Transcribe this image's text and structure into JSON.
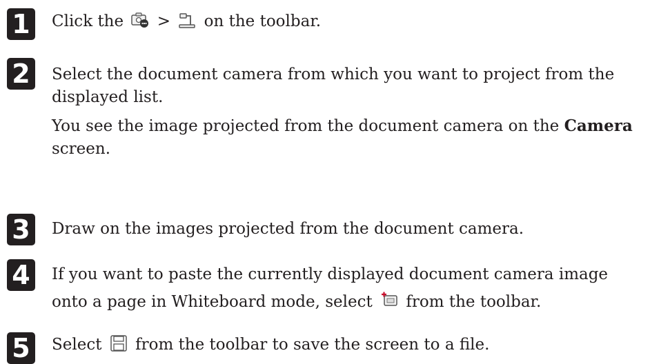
{
  "steps": [
    {
      "number": "1",
      "text_before": "Click the",
      "separator": ">",
      "text_after": "on the toolbar.",
      "icons": [
        "camera-toolbox-icon",
        "document-camera-icon"
      ]
    },
    {
      "number": "2",
      "line1": "Select the document camera from which you want to project from the displayed list.",
      "line2_before": "You see the image projected from the document camera on the",
      "line2_bold": "Camera",
      "line2_after": "screen."
    },
    {
      "number": "3",
      "text": "Draw on the images projected from the document camera."
    },
    {
      "number": "4",
      "text_before": "If you want to paste the currently displayed document camera image onto a page in Whiteboard mode, select",
      "text_after": "from the toolbar.",
      "icons": [
        "paste-image-icon"
      ]
    },
    {
      "number": "5",
      "text_before": "Select",
      "text_after": "from the toolbar to save the screen to a file.",
      "icons": [
        "save-icon"
      ]
    }
  ],
  "colors": {
    "text": "#231f20",
    "badge_background": "#231f20",
    "badge_text": "#ffffff",
    "icon_red": "#c8102e"
  }
}
